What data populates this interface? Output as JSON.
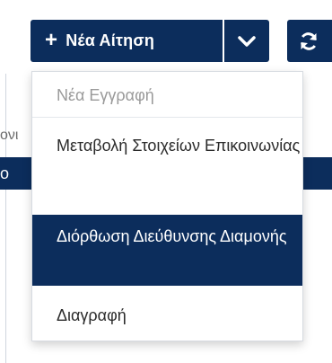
{
  "toolbar": {
    "new_request_label": "Νέα Αίτηση",
    "plus_glyph": "+",
    "accent_color": "#0c2d5c",
    "dropdown_icon": "chevron-down-icon",
    "refresh_icon": "refresh-icon"
  },
  "menu": {
    "header": "Νέα Εγγραφή",
    "items": [
      {
        "label": "Μεταβολή Στοιχείων Επικοινωνίας",
        "active": false
      },
      {
        "label": "Διόρθωση Διεύθυνσης Διαμονής",
        "active": true
      },
      {
        "label": "Διαγραφή",
        "active": false
      }
    ]
  },
  "background": {
    "clipped_text": "ονι",
    "row_text": "ο"
  }
}
